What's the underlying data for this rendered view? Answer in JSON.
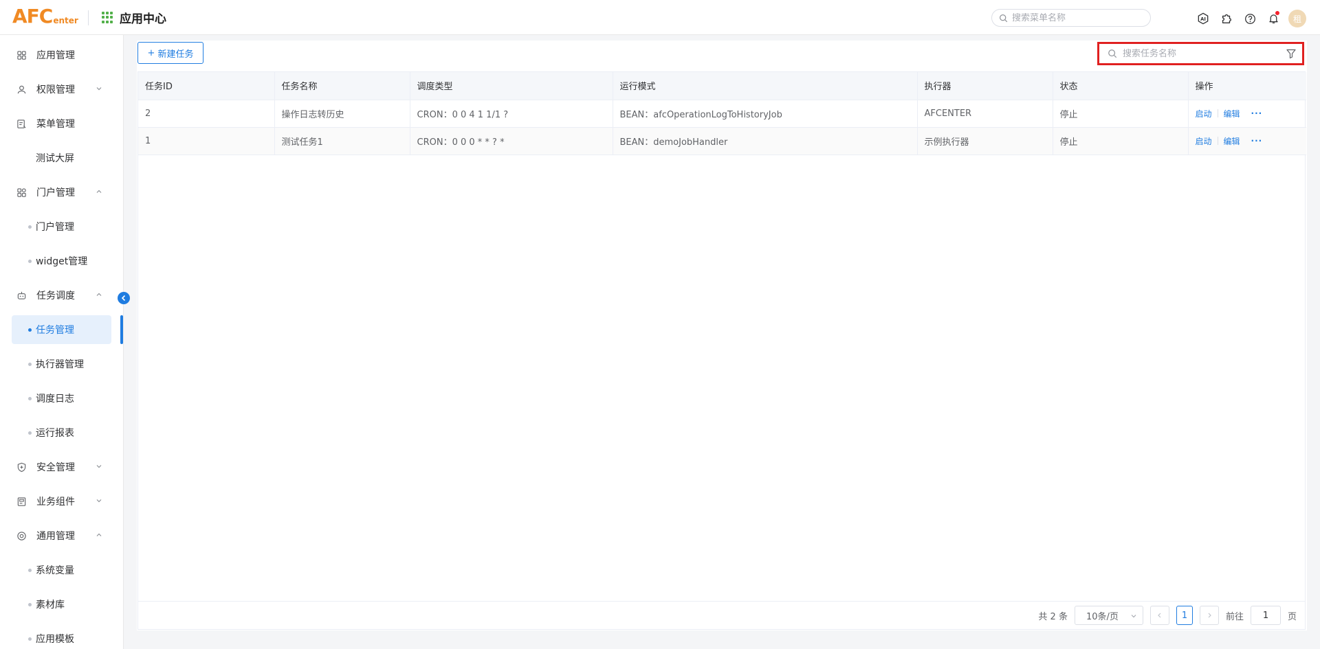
{
  "header": {
    "logo_big": "AFC",
    "logo_small": "enter",
    "app_center_label": "应用中心",
    "menu_search_placeholder": "搜索菜单名称",
    "avatar_text": "租",
    "icons": [
      "ai-icon",
      "puzzle-icon",
      "help-icon",
      "bell-icon"
    ]
  },
  "sidebar": {
    "items": [
      {
        "label": "应用管理",
        "type": "top",
        "icon": "apps-icon"
      },
      {
        "label": "权限管理",
        "type": "top",
        "icon": "user-icon",
        "arrow": "down"
      },
      {
        "label": "菜单管理",
        "type": "top",
        "icon": "menu-doc-icon"
      },
      {
        "label": "测试大屏",
        "type": "plain"
      },
      {
        "label": "门户管理",
        "type": "top",
        "icon": "portal-icon",
        "arrow": "up"
      },
      {
        "label": "门户管理",
        "type": "sub"
      },
      {
        "label": "widget管理",
        "type": "sub"
      },
      {
        "label": "任务调度",
        "type": "top",
        "icon": "robot-icon",
        "arrow": "up"
      },
      {
        "label": "任务管理",
        "type": "sub",
        "active": true
      },
      {
        "label": "执行器管理",
        "type": "sub"
      },
      {
        "label": "调度日志",
        "type": "sub"
      },
      {
        "label": "运行报表",
        "type": "sub"
      },
      {
        "label": "安全管理",
        "type": "top",
        "icon": "shield-icon",
        "arrow": "down"
      },
      {
        "label": "业务组件",
        "type": "top",
        "icon": "component-icon",
        "arrow": "down"
      },
      {
        "label": "通用管理",
        "type": "top",
        "icon": "settings-icon",
        "arrow": "up"
      },
      {
        "label": "系统变量",
        "type": "sub"
      },
      {
        "label": "素材库",
        "type": "sub"
      },
      {
        "label": "应用模板",
        "type": "sub"
      }
    ]
  },
  "toolbar": {
    "new_task_label": "新建任务",
    "task_search_placeholder": "搜索任务名称"
  },
  "table": {
    "columns": [
      "任务ID",
      "任务名称",
      "调度类型",
      "运行模式",
      "执行器",
      "状态",
      "操作"
    ],
    "rows": [
      {
        "id": "2",
        "name": "操作日志转历史",
        "schedule": "CRON：0 0 4 1 1/1 ?",
        "mode": "BEAN：afcOperationLogToHistoryJob",
        "executor": "AFCENTER",
        "status": "停止"
      },
      {
        "id": "1",
        "name": "测试任务1",
        "schedule": "CRON：0 0 0 * * ? *",
        "mode": "BEAN：demoJobHandler",
        "executor": "示例执行器",
        "status": "停止"
      }
    ],
    "action_start": "启动",
    "action_edit": "编辑",
    "action_more": "···"
  },
  "pagination": {
    "total_text": "共 2 条",
    "page_size": "10条/页",
    "current_page": "1",
    "goto_label": "前往",
    "goto_value": "1",
    "page_suffix": "页"
  },
  "colors": {
    "accent": "#1f7ce0",
    "logo": "#f08a24",
    "highlight_border": "#e02020"
  }
}
